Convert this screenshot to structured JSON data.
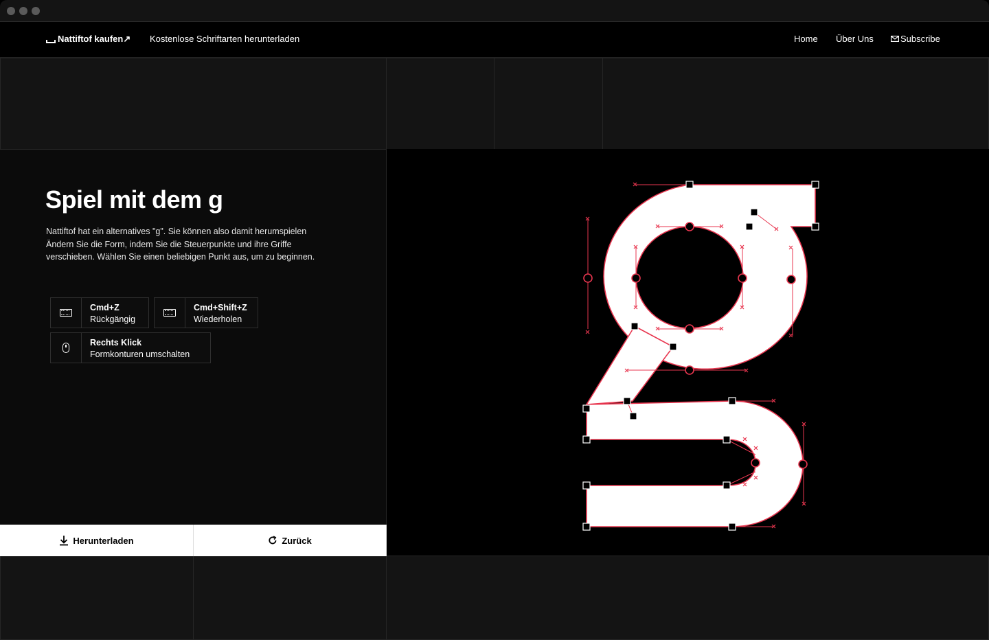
{
  "nav": {
    "brand_label": "Nattiftof kaufen↗",
    "free_fonts_label": "Kostenlose Schriftarten herunterladen",
    "home_label": "Home",
    "about_label": "Über Uns",
    "subscribe_label": "Subscribe"
  },
  "hero": {
    "title": "Spiel mit dem g",
    "description_lines": [
      "Nattiftof hat ein alternatives \"g\". Sie können also damit herumspielen",
      "Ändern Sie die Form, indem Sie die Steuerpunkte und ihre Griffe",
      "verschieben. Wählen Sie einen beliebigen Punkt aus, um zu beginnen."
    ]
  },
  "shortcuts": [
    {
      "icon": "keyboard-icon",
      "keys": "Cmd+Z",
      "action": "Rückgängig"
    },
    {
      "icon": "keyboard-icon",
      "keys": "Cmd+Shift+Z",
      "action": "Wiederholen"
    },
    {
      "icon": "mouse-icon",
      "keys": "Rechts Klick",
      "action": "Formkonturen umschalten"
    }
  ],
  "actions": {
    "download_label": "Herunterladen",
    "back_label": "Zurück"
  },
  "colors": {
    "accent": "#e8364f",
    "glyph_fill": "#ffffff",
    "canvas_bg": "#000000",
    "grid_bg": "#141414"
  }
}
